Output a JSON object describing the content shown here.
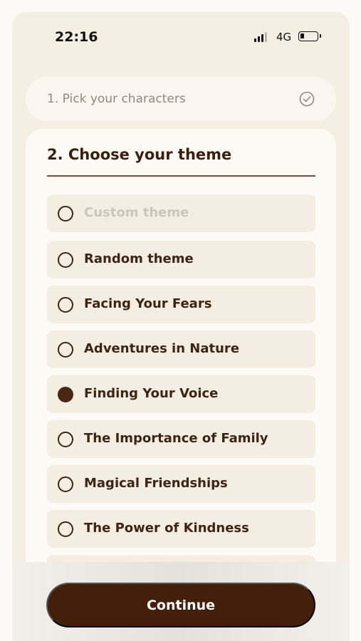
{
  "status_bar": {
    "time": "22:16",
    "network": "4G",
    "icons": [
      "cellular-signal-icon",
      "battery-icon"
    ]
  },
  "step1": {
    "label": "1. Pick your characters",
    "icon": "check-circle-icon",
    "completed": true
  },
  "step2": {
    "title": "2. Choose your theme",
    "options": [
      {
        "label": "Custom theme",
        "selected": false,
        "placeholder": true
      },
      {
        "label": "Random theme",
        "selected": false
      },
      {
        "label": "Facing Your Fears",
        "selected": false
      },
      {
        "label": "Adventures in Nature",
        "selected": false
      },
      {
        "label": "Finding Your Voice",
        "selected": true
      },
      {
        "label": "The Importance of Family",
        "selected": false
      },
      {
        "label": "Magical Friendships",
        "selected": false
      },
      {
        "label": "The Power of Kindness",
        "selected": false
      }
    ]
  },
  "continue_label": "Continue",
  "colors": {
    "accent_brown": "#44200a",
    "text_brown": "#3d2414",
    "background": "#f4efe2",
    "option_bg": "#f4eee2"
  }
}
